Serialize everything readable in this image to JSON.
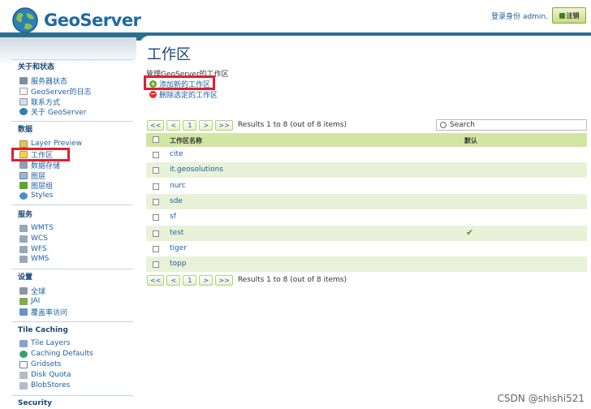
{
  "header": {
    "brand": "GeoServer",
    "login_text": "登录身份 admin.",
    "logout_label": "注销"
  },
  "sidebar": {
    "sections": [
      {
        "title": "关于和状态",
        "items": [
          {
            "label": "服务器状态",
            "icon": "server-status-icon"
          },
          {
            "label": "GeoServer的日志",
            "icon": "log-icon"
          },
          {
            "label": "联系方式",
            "icon": "contact-icon"
          },
          {
            "label": "关于 GeoServer",
            "icon": "about-icon"
          }
        ]
      },
      {
        "title": "数据",
        "items": [
          {
            "label": "Layer Preview",
            "icon": "layer-preview-icon"
          },
          {
            "label": "工作区",
            "icon": "workspace-folder-icon"
          },
          {
            "label": "数据存储",
            "icon": "datastore-icon"
          },
          {
            "label": "图层",
            "icon": "layer-icon"
          },
          {
            "label": "图层组",
            "icon": "layergroup-icon"
          },
          {
            "label": "Styles",
            "icon": "styles-icon"
          }
        ]
      },
      {
        "title": "服务",
        "items": [
          {
            "label": "WMTS",
            "icon": "service-icon"
          },
          {
            "label": "WCS",
            "icon": "service-icon"
          },
          {
            "label": "WFS",
            "icon": "service-icon"
          },
          {
            "label": "WMS",
            "icon": "service-icon"
          }
        ]
      },
      {
        "title": "设置",
        "items": [
          {
            "label": "全球",
            "icon": "global-settings-icon"
          },
          {
            "label": "JAI",
            "icon": "jai-icon"
          },
          {
            "label": "覆盖率访问",
            "icon": "coverage-icon"
          }
        ]
      },
      {
        "title": "Tile Caching",
        "items": [
          {
            "label": "Tile Layers",
            "icon": "tile-layers-icon"
          },
          {
            "label": "Caching Defaults",
            "icon": "caching-defaults-icon"
          },
          {
            "label": "Gridsets",
            "icon": "gridsets-icon"
          },
          {
            "label": "Disk Quota",
            "icon": "disk-quota-icon"
          },
          {
            "label": "BlobStores",
            "icon": "blobstores-icon"
          }
        ]
      },
      {
        "title": "Security",
        "items": []
      }
    ]
  },
  "main": {
    "title": "工作区",
    "description": "管理GeoServer的工作区",
    "add_label": "添加新的工作区",
    "remove_label": "删除选定的工作区",
    "pager": {
      "first": "<<",
      "prev": "<",
      "page": "1",
      "next": ">",
      "last": ">>",
      "results": "Results 1 to 8 (out of 8 items)"
    },
    "search_placeholder": "Search",
    "table": {
      "col_name": "工作区名称",
      "col_default": "默认",
      "rows": [
        {
          "name": "cite",
          "default": false
        },
        {
          "name": "it.geosolutions",
          "default": false
        },
        {
          "name": "nurc",
          "default": false
        },
        {
          "name": "sde",
          "default": false
        },
        {
          "name": "sf",
          "default": false
        },
        {
          "name": "test",
          "default": true
        },
        {
          "name": "tiger",
          "default": false
        },
        {
          "name": "topp",
          "default": false
        }
      ]
    }
  },
  "watermark": "CSDN @shishi521",
  "colors": {
    "brand_blue": "#1e6aa5",
    "topbar": "#2a6f8d",
    "row_alt": "#e9f2d8",
    "header_row": "#d2e5a2",
    "highlight_red": "#e0202c"
  }
}
